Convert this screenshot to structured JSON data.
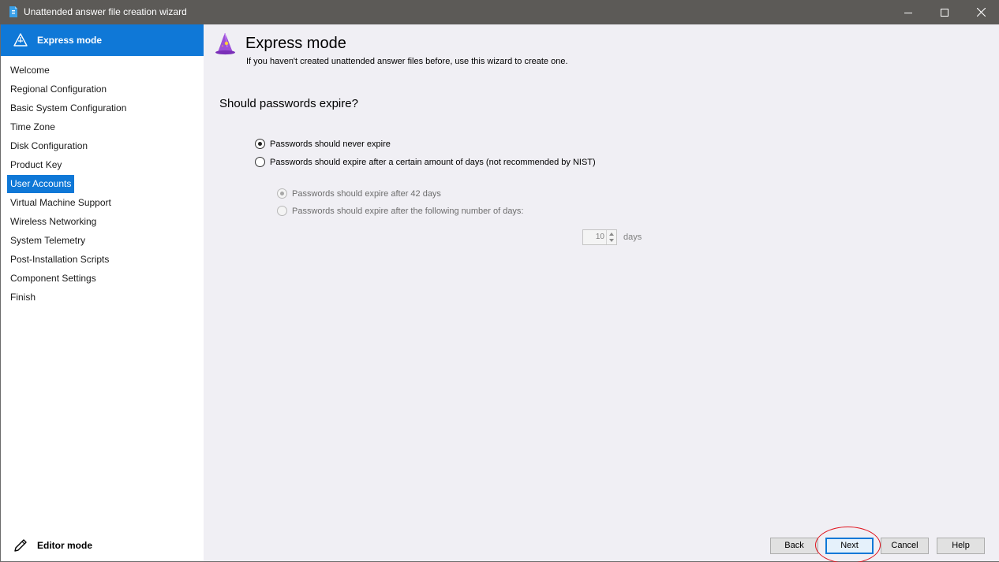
{
  "window": {
    "title": "Unattended answer file creation wizard",
    "icon": "document-icon"
  },
  "sidebar": {
    "header_label": "Express mode",
    "header_icon": "wizard-triangle-icon",
    "items": [
      {
        "label": "Welcome"
      },
      {
        "label": "Regional Configuration"
      },
      {
        "label": "Basic System Configuration"
      },
      {
        "label": "Time Zone"
      },
      {
        "label": "Disk Configuration"
      },
      {
        "label": "Product Key"
      },
      {
        "label": "User Accounts"
      },
      {
        "label": "Virtual Machine Support"
      },
      {
        "label": "Wireless Networking"
      },
      {
        "label": "System Telemetry"
      },
      {
        "label": "Post-Installation Scripts"
      },
      {
        "label": "Component Settings"
      },
      {
        "label": "Finish"
      }
    ],
    "active_item": "User Accounts",
    "editor_mode_label": "Editor mode"
  },
  "main": {
    "title": "Express mode",
    "subtitle": "If you haven't created unattended answer files before, use this wizard to create one.",
    "question": "Should passwords expire?",
    "options": {
      "never": "Passwords should never expire",
      "expire": "Passwords should expire after a certain amount of days (not recommended by NIST)"
    },
    "sub_options": {
      "default_days": "Passwords should expire after 42 days",
      "custom_days": "Passwords should expire after the following number of days:"
    },
    "days_value": "10",
    "days_unit": "days"
  },
  "buttons": {
    "back": "Back",
    "next": "Next",
    "cancel": "Cancel",
    "help": "Help"
  },
  "colors": {
    "accent": "#0f78d7",
    "titlebar": "#5c5a57",
    "content_bg": "#f0eff4",
    "annotation": "#e0141e"
  }
}
